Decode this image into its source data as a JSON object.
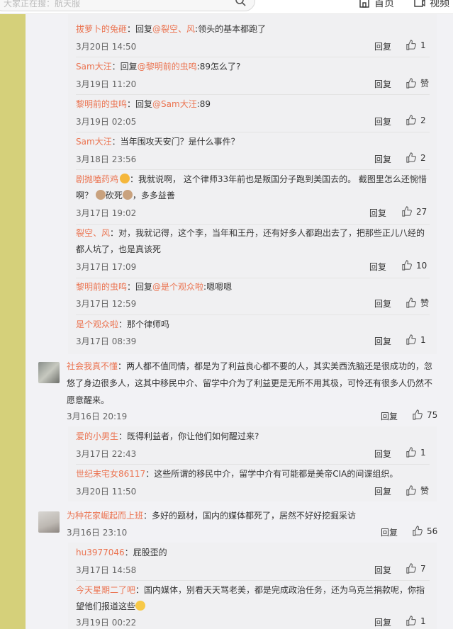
{
  "header": {
    "search_placeholder": "大家正在搜：航天服",
    "home_label": "首页",
    "video_label": "视频"
  },
  "ui": {
    "reply_label": "回复",
    "like_label": "赞"
  },
  "comments": [
    {
      "user": "拔萝卜的兔砸",
      "prefix": "：回复",
      "mention": "@裂空、风",
      "text": ":领头的基本都跑了",
      "time": "3月20日 14:50",
      "likes": "1"
    },
    {
      "user": "Sam大汪",
      "prefix": "：回复",
      "mention": "@黎明前的虫鸣",
      "text": ":89怎么了?",
      "time": "3月19日 11:20",
      "likes": "赞"
    },
    {
      "user": "黎明前的虫鸣",
      "prefix": "：回复",
      "mention": "@Sam大汪",
      "text": ":89",
      "time": "3月19日 02:05",
      "likes": "2"
    },
    {
      "user": "Sam大汪",
      "prefix": "：当年围攻天安门？是什么事件？",
      "mention": "",
      "text": "",
      "time": "3月18日 23:56",
      "likes": "2"
    },
    {
      "user": "剧抛嗑药鸡",
      "text_line1": "：我就说啊， 这个律师33年前也是叛国分子跑到美国去的。 截图里怎么还惋惜",
      "text_line2_a": "啊？ ",
      "text_line2_b": "砍死",
      "text_line2_c": "，多多益善",
      "time": "3月17日 19:02",
      "likes": "27"
    },
    {
      "user": "裂空、风",
      "text_line1": "：对，我就记得，这个李，当年和王丹，还有好多人都跑出去了，把那些正儿八经的",
      "text_line2": "都人坑了，也是真该死",
      "time": "3月17日 17:09",
      "likes": "10"
    },
    {
      "user": "黎明前的虫鸣",
      "prefix": "：回复",
      "mention": "@是个观众啦",
      "text": ":嗯嗯嗯",
      "time": "3月17日 12:59",
      "likes": "赞"
    },
    {
      "user": "是个观众啦",
      "prefix": "：那个律师吗",
      "mention": "",
      "text": "",
      "time": "3月17日 08:39",
      "likes": "1"
    }
  ],
  "main_comment_1": {
    "user": "社会我真不懂",
    "line1": "：两人都不值同情，都是为了利益良心都不要的人，其实美西洗脑还是很成功的，忽",
    "line2": "悠了身边很多人，这其中移民中介、留学中介为了利益更是无所不用其极，可怜还有很多人仍然不",
    "line3": "愿意醒来。",
    "time": "3月16日 20:19",
    "likes": "75"
  },
  "replies_1": [
    {
      "user": "爱的小男生",
      "text": "：既得利益者，你让他们如何醒过来?",
      "time": "3月17日 22:43",
      "likes": "1"
    },
    {
      "user": "世纪末宅女86117",
      "text": "：这些所谓的移民中介，留学中介有可能都是美帝CIA的间谍组织。",
      "time": "3月20日 11:50",
      "likes": "赞"
    }
  ],
  "main_comment_2": {
    "user": "为种花家崛起而上班",
    "text": "：多好的题材，国内的媒体都死了，居然不好好挖掘采访",
    "time": "3月16日 23:10",
    "likes": "56"
  },
  "replies_2": [
    {
      "user": "hu3977046",
      "text": "：屁股歪的",
      "time": "3月17日 14:58",
      "likes": "7"
    },
    {
      "user": "今天星期二了吧",
      "line1": "：国内媒体，别看天天骂老美，都是完成政治任务，还为乌克兰捐款呢，你指",
      "line2": "望他们报道这些",
      "time": "3月19日 00:22",
      "likes": "1"
    }
  ]
}
